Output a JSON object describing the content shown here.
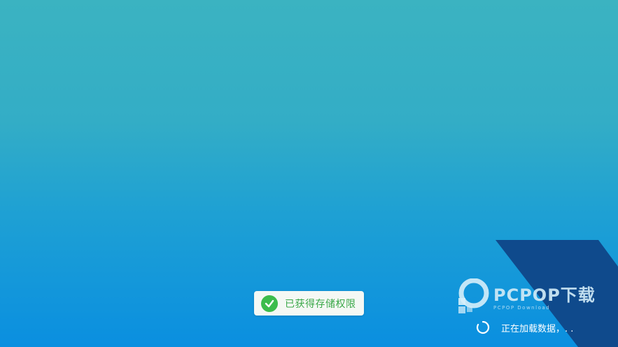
{
  "toast": {
    "message": "已获得存储权限",
    "icon": "check-circle-icon",
    "color": "#3cbc4c"
  },
  "watermark": {
    "brand": "PCPOP下载",
    "tagline": "PCPOP Download"
  },
  "loading": {
    "text": "正在加载数据，. .",
    "icon": "spinner-icon"
  },
  "colors": {
    "background_top": "#3bb3c1",
    "background_bottom": "#0a8fe0",
    "corner": "#0f4a8c"
  }
}
